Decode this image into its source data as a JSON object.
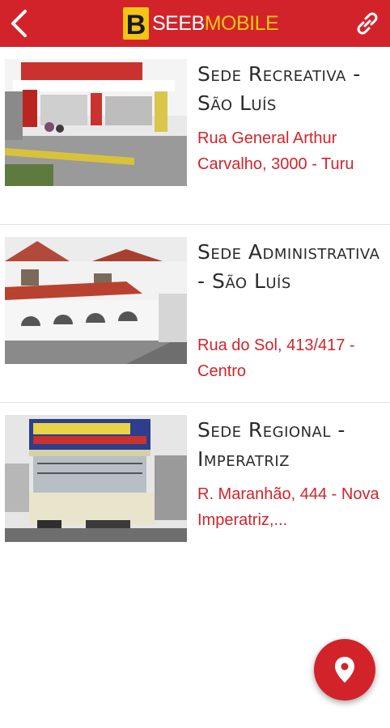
{
  "header": {
    "back_icon": "chevron-left-icon",
    "brand_logo_letter": "B",
    "brand_seeb": "SEEB",
    "brand_mobile": "MOBILE",
    "link_icon": "link-icon"
  },
  "locations": [
    {
      "title": "Sede Recreativa - São Luís",
      "address": "Rua General Arthur Carvalho, 3000 - Turu",
      "photo": "building-photo"
    },
    {
      "title": "Sede Administrativa - São Luís",
      "address": "Rua do Sol, 413/417 - Centro",
      "photo": "building-photo"
    },
    {
      "title": "Sede Regional - Imperatriz",
      "address": "R. Maranhão, 444 - Nova Imperatriz,...",
      "photo": "building-photo"
    }
  ],
  "fab": {
    "icon": "map-pin-icon"
  },
  "colors": {
    "primary": "#d3232a",
    "brand_yellow": "#f3c516",
    "title_text": "#2a2a2a"
  }
}
